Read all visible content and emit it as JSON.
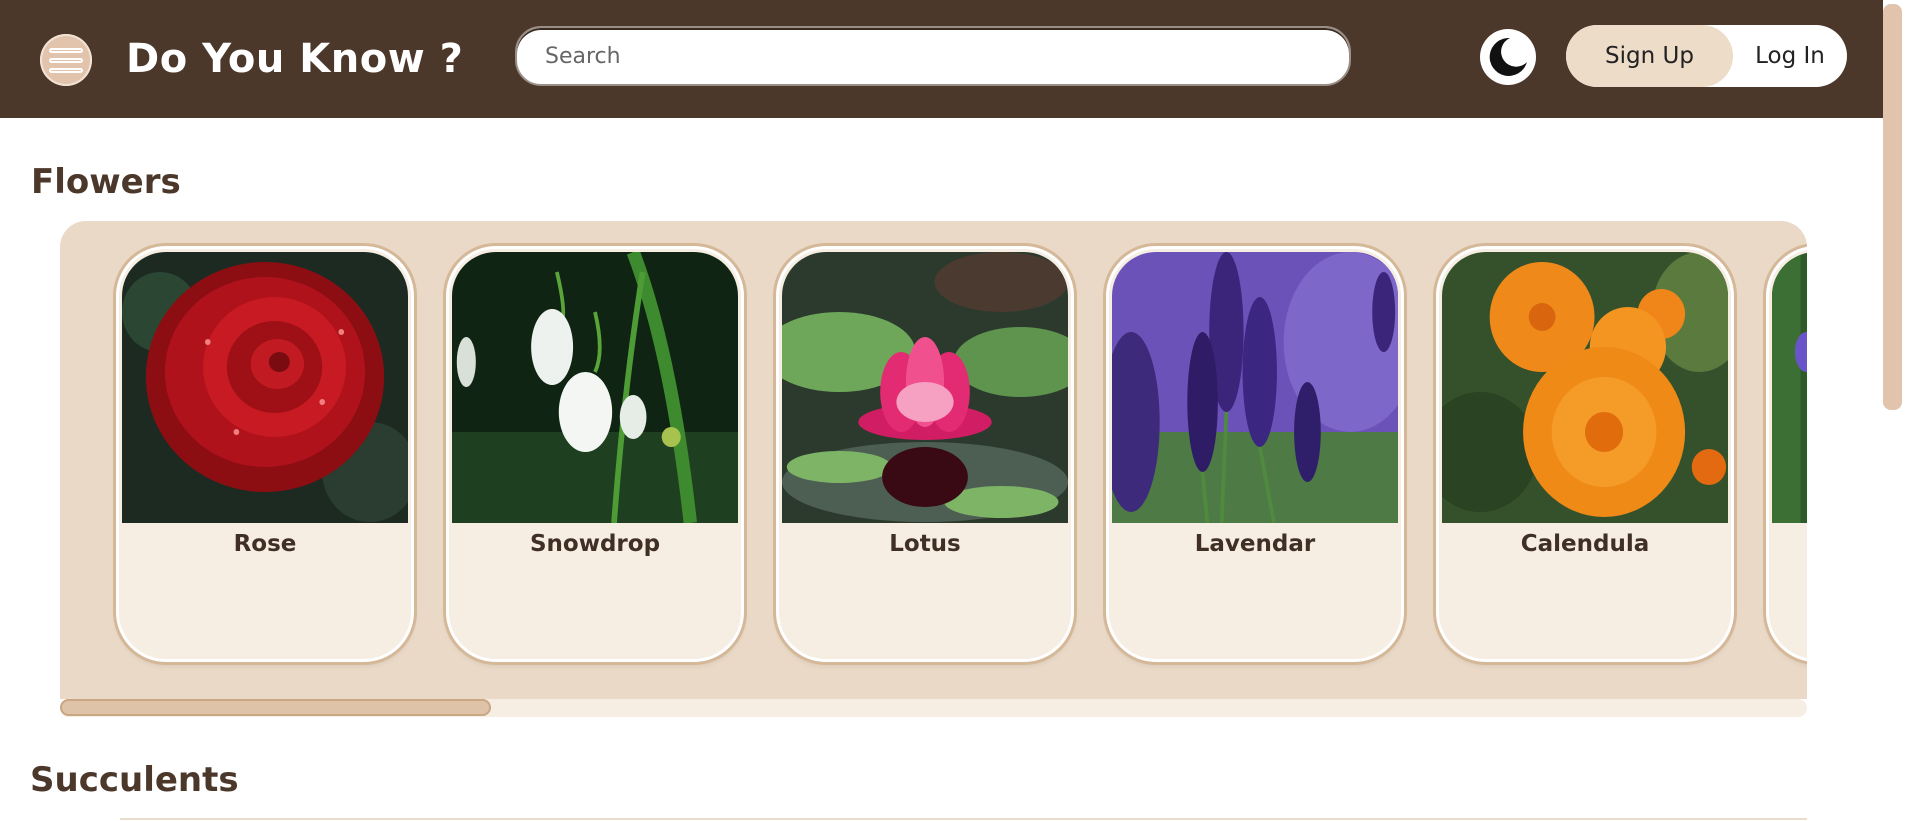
{
  "header": {
    "logo_text": "Do You Know ?",
    "search_placeholder": "Search",
    "theme_icon": "moon-icon",
    "signup_label": "Sign Up",
    "login_label": "Log In"
  },
  "sections": [
    {
      "title": "Flowers",
      "cards": [
        {
          "label": "Rose"
        },
        {
          "label": "Snowdrop"
        },
        {
          "label": "Lotus"
        },
        {
          "label": "Lavendar"
        },
        {
          "label": "Calendula"
        }
      ]
    },
    {
      "title": "Succulents"
    }
  ],
  "colors": {
    "header_bg": "#4c372b",
    "panel_bg": "#ead9c7",
    "card_bg": "#f6ede3",
    "accent": "#e2c4ad"
  }
}
